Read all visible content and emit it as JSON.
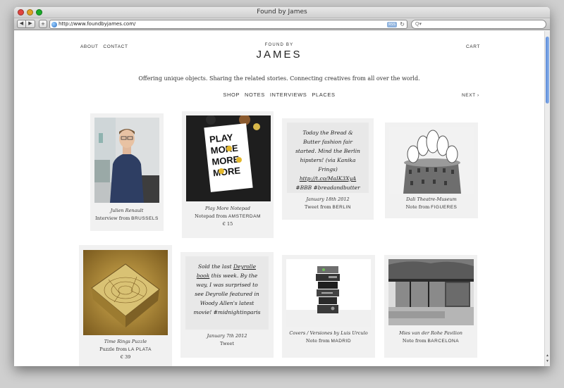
{
  "window": {
    "title": "Found by James"
  },
  "browser": {
    "url": "http://www.foundbyjames.com/",
    "rss_label": "RSS",
    "search_placeholder": "Q▾"
  },
  "header": {
    "nav_left": [
      "ABOUT",
      "CONTACT"
    ],
    "brand_small": "FOUND BY",
    "brand_big": "JAMES",
    "cart": "CART",
    "tagline": "Offering unique objects. Sharing the related stories. Connecting creatives from all over the world.",
    "categories": [
      "SHOP",
      "NOTES",
      "INTERVIEWS",
      "PLACES"
    ],
    "next": "NEXT ›"
  },
  "cards": [
    {
      "title": "Julien Renault",
      "kind": "Interview from",
      "loc": "BRUSSELS"
    },
    {
      "title": "Play More Notepad",
      "kind": "Notepad from",
      "loc": "AMSTERDAM",
      "price": "€ 15"
    },
    {
      "tweet_pre": "Today the Bread & Butter fashion fair started. Mind the Berlin hipsters! (via Kanika Frings) ",
      "tweet_link": "http://t.co/MaIK3XyA",
      "tweet_post": " #BBB #breadandbutter",
      "date": "January 18th 2012",
      "kind": "Tweet from",
      "loc": "BERLIN"
    },
    {
      "title": "Dali Theatre-Museum",
      "kind": "Note from",
      "loc": "FIGUERES"
    },
    {
      "title": "Time Rings Puzzle",
      "kind": "Puzzle from",
      "loc": "LA PLATA",
      "price": "€ 39"
    },
    {
      "tweet_pre": "Sold the last ",
      "tweet_link": "Deyrolle book",
      "tweet_post": " this week. By the way, I was surprised to see Deyrolle featured in Woody Allen's latest movie! #midnightinparis",
      "date": "January 7th 2012",
      "kind": "Tweet",
      "loc": ""
    },
    {
      "title": "Covers / Versiones by Luis Urculo",
      "kind": "Note from",
      "loc": "MADRID"
    },
    {
      "title": "Mies van der Rohe Pavilion",
      "kind": "Note from",
      "loc": "BARCELONA"
    }
  ],
  "notepad_cover": {
    "words": [
      "PLAY",
      "MORE",
      "MORE",
      "MORE"
    ]
  },
  "colors": {
    "accent_blue": "#2b6fc4",
    "card_bg": "#f1f1f1",
    "tweet_bg": "#e8e8e8"
  }
}
